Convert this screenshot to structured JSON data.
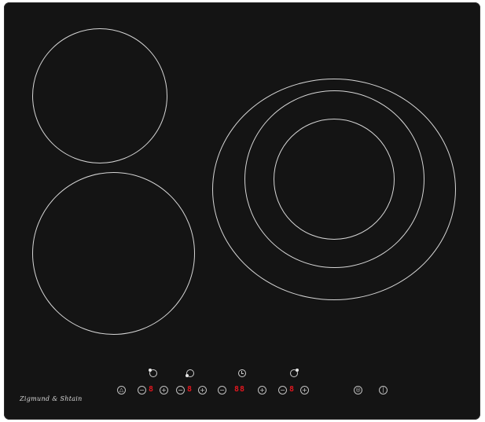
{
  "brand": {
    "logo_text": "Zigmund & Shtain"
  },
  "cooking_zones": [
    {
      "id": "rear-left",
      "rings": 1
    },
    {
      "id": "front-left",
      "rings": 1
    },
    {
      "id": "right-triple",
      "rings": 3
    }
  ],
  "control_panel": {
    "zone_icons": [
      "zone-rear-left-icon",
      "zone-front-left-icon",
      "timer-icon",
      "zone-right-icon"
    ],
    "displays": {
      "zone_1": "8",
      "zone_2": "8",
      "timer": "88",
      "zone_3": "8"
    },
    "buttons": {
      "lock_icon": "lock-icon",
      "minus_glyph": "−",
      "plus_glyph": "+",
      "boost_icon": "multi-zone-icon",
      "power_icon": "power-icon"
    }
  },
  "colors": {
    "glass": "#141414",
    "ring": "#d6d6d6",
    "display_red": "#e0171f"
  }
}
